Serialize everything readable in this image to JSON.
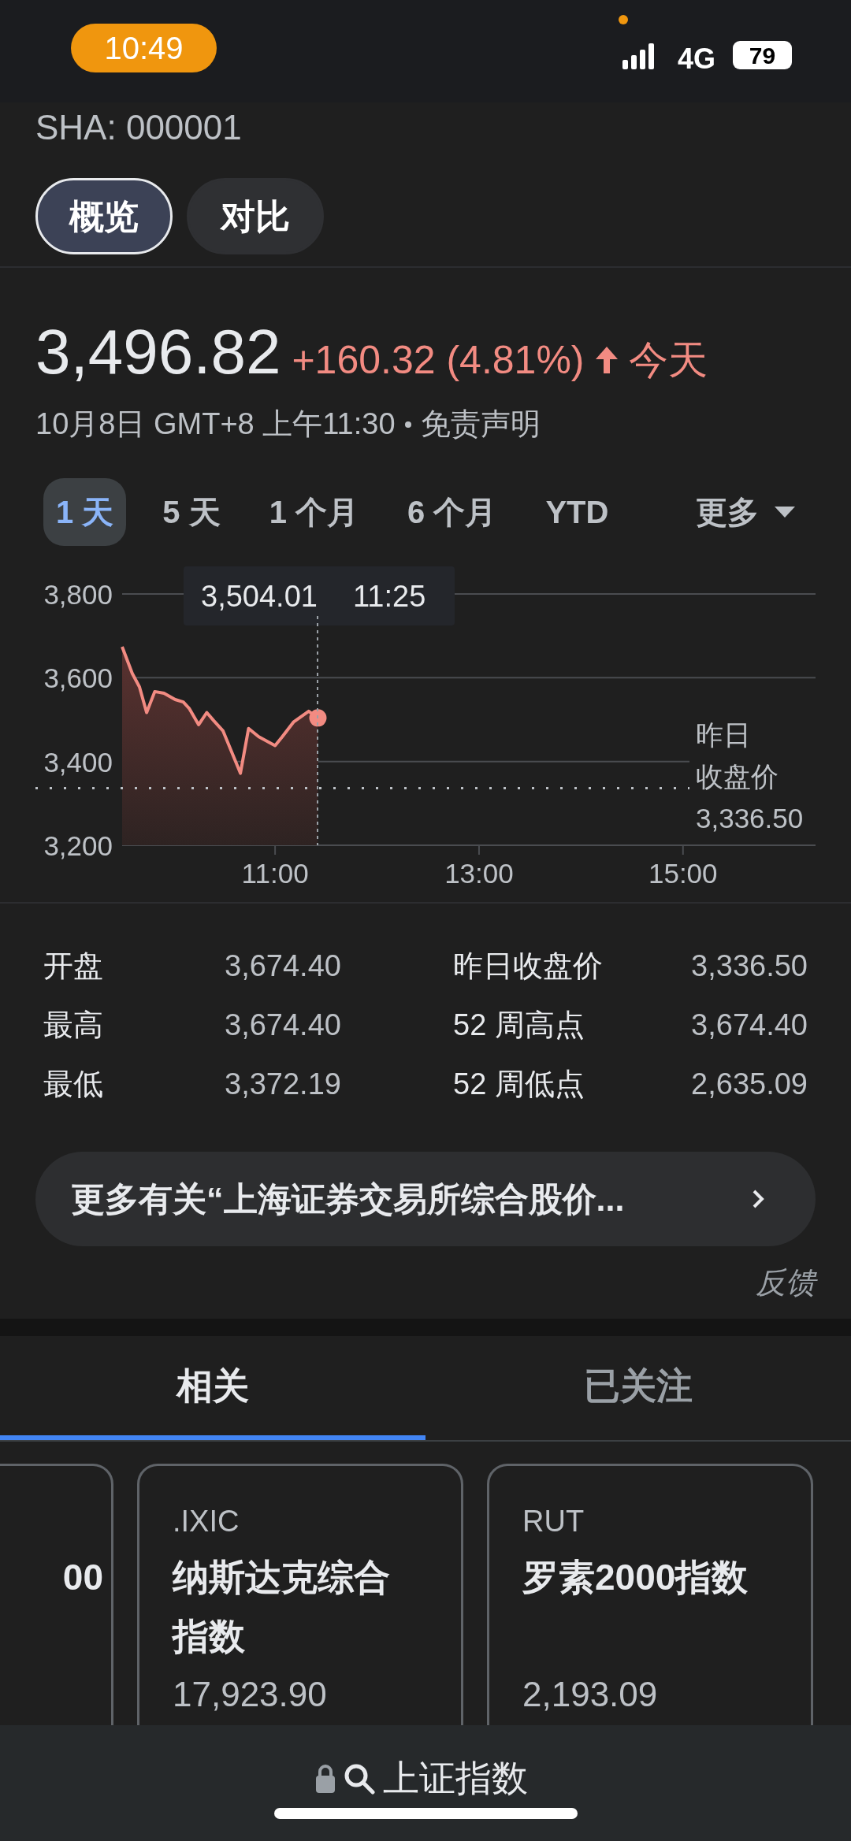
{
  "status_bar": {
    "time": "10:49",
    "network": "4G",
    "battery": "79"
  },
  "header": {
    "ticker": "SHA: 000001",
    "tabs": [
      {
        "label": "概览",
        "selected": true
      },
      {
        "label": "对比",
        "selected": false
      }
    ]
  },
  "quote": {
    "price": "3,496.82",
    "change": "+160.32 (4.81%)",
    "period": "今天",
    "timestamp": "10月8日 GMT+8 上午11:30",
    "disclaimer": "免责声明"
  },
  "ranges": [
    {
      "label": "1 天",
      "selected": true
    },
    {
      "label": "5 天",
      "selected": false
    },
    {
      "label": "1 个月",
      "selected": false
    },
    {
      "label": "6 个月",
      "selected": false
    },
    {
      "label": "YTD",
      "selected": false
    },
    {
      "label": "更多",
      "selected": false,
      "kind": "dropdown"
    }
  ],
  "chart": {
    "chart_data": {
      "type": "area",
      "x": [
        9.5,
        9.6,
        9.67,
        9.74,
        9.82,
        9.91,
        10.02,
        10.1,
        10.16,
        10.25,
        10.33,
        10.4,
        10.49,
        10.66,
        10.74,
        10.84,
        11.0,
        11.07,
        11.18,
        11.33,
        11.42
      ],
      "series": [
        {
          "color": "#f28b82",
          "values": [
            3674,
            3610,
            3578,
            3517,
            3567,
            3563,
            3548,
            3542,
            3526,
            3488,
            3517,
            3497,
            3473,
            3372,
            3479,
            3459,
            3438,
            3459,
            3494,
            3520,
            3504
          ]
        }
      ],
      "xlim": [
        9.5,
        16.3
      ],
      "ylim": [
        3200,
        3800
      ],
      "xticks": [
        {
          "value": 11,
          "label": "11:00"
        },
        {
          "value": 13,
          "label": "13:00"
        },
        {
          "value": 15,
          "label": "15:00"
        }
      ],
      "yticks": [
        {
          "value": 3800,
          "label": "3,800"
        },
        {
          "value": 3600,
          "label": "3,600"
        },
        {
          "value": 3400,
          "label": "3,400"
        },
        {
          "value": 3200,
          "label": "3,200"
        }
      ],
      "ref_lines": [
        {
          "axis": "y",
          "value": 3336.5,
          "label": "3,336.50"
        }
      ]
    },
    "previous_close_caption": [
      "昨日",
      "收盘价"
    ],
    "tooltip": {
      "value": "3,504.01",
      "time": "11:25"
    }
  },
  "stats": [
    {
      "label": "开盘",
      "value": "3,674.40"
    },
    {
      "label": "昨日收盘价",
      "value": "3,336.50"
    },
    {
      "label": "最高",
      "value": "3,674.40"
    },
    {
      "label": "52 周高点",
      "value": "3,674.40"
    },
    {
      "label": "最低",
      "value": "3,372.19"
    },
    {
      "label": "52 周低点",
      "value": "2,635.09"
    }
  ],
  "more_button": "更多有关“上海证券交易所综合股价...",
  "feedback": "反馈",
  "related_tabs": [
    {
      "label": "相关",
      "selected": true
    },
    {
      "label": "已关注",
      "selected": false
    }
  ],
  "cards": [
    {
      "name": "00"
    },
    {
      "symbol": ".IXIC",
      "name": "纳斯达克综合指数",
      "value": "17,923.90"
    },
    {
      "symbol": "RUT",
      "name": "罗素2000指数",
      "value": "2,193.09"
    }
  ],
  "address_bar": {
    "text": "上证指数"
  }
}
